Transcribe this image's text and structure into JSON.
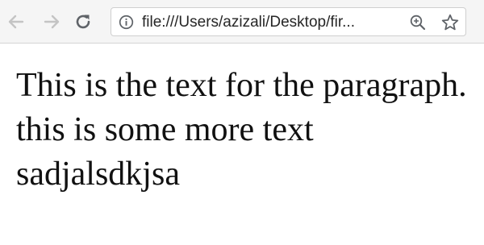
{
  "browser": {
    "back_icon": "arrow-left-icon",
    "forward_icon": "arrow-right-icon",
    "reload_icon": "reload-icon",
    "address_bar": {
      "info_icon": "info-circle-icon",
      "url": "file:///Users/azizali/Desktop/fir...",
      "zoom_icon": "zoom-icon",
      "bookmark_icon": "star-outline-icon"
    },
    "colors": {
      "toolbar_bg": "#f5f5f5",
      "icon_disabled": "#c4c4c4",
      "icon_active": "#5f6368"
    }
  },
  "page": {
    "paragraph": "This is the text for the paragraph. this is some more text sadjalsdkjsa"
  }
}
